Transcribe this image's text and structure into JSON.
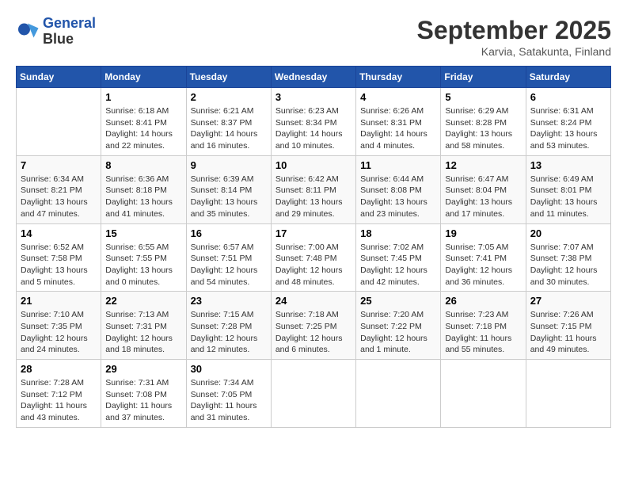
{
  "header": {
    "logo_line1": "General",
    "logo_line2": "Blue",
    "month": "September 2025",
    "location": "Karvia, Satakunta, Finland"
  },
  "days_of_week": [
    "Sunday",
    "Monday",
    "Tuesday",
    "Wednesday",
    "Thursday",
    "Friday",
    "Saturday"
  ],
  "weeks": [
    [
      {
        "num": "",
        "info": ""
      },
      {
        "num": "1",
        "info": "Sunrise: 6:18 AM\nSunset: 8:41 PM\nDaylight: 14 hours\nand 22 minutes."
      },
      {
        "num": "2",
        "info": "Sunrise: 6:21 AM\nSunset: 8:37 PM\nDaylight: 14 hours\nand 16 minutes."
      },
      {
        "num": "3",
        "info": "Sunrise: 6:23 AM\nSunset: 8:34 PM\nDaylight: 14 hours\nand 10 minutes."
      },
      {
        "num": "4",
        "info": "Sunrise: 6:26 AM\nSunset: 8:31 PM\nDaylight: 14 hours\nand 4 minutes."
      },
      {
        "num": "5",
        "info": "Sunrise: 6:29 AM\nSunset: 8:28 PM\nDaylight: 13 hours\nand 58 minutes."
      },
      {
        "num": "6",
        "info": "Sunrise: 6:31 AM\nSunset: 8:24 PM\nDaylight: 13 hours\nand 53 minutes."
      }
    ],
    [
      {
        "num": "7",
        "info": "Sunrise: 6:34 AM\nSunset: 8:21 PM\nDaylight: 13 hours\nand 47 minutes."
      },
      {
        "num": "8",
        "info": "Sunrise: 6:36 AM\nSunset: 8:18 PM\nDaylight: 13 hours\nand 41 minutes."
      },
      {
        "num": "9",
        "info": "Sunrise: 6:39 AM\nSunset: 8:14 PM\nDaylight: 13 hours\nand 35 minutes."
      },
      {
        "num": "10",
        "info": "Sunrise: 6:42 AM\nSunset: 8:11 PM\nDaylight: 13 hours\nand 29 minutes."
      },
      {
        "num": "11",
        "info": "Sunrise: 6:44 AM\nSunset: 8:08 PM\nDaylight: 13 hours\nand 23 minutes."
      },
      {
        "num": "12",
        "info": "Sunrise: 6:47 AM\nSunset: 8:04 PM\nDaylight: 13 hours\nand 17 minutes."
      },
      {
        "num": "13",
        "info": "Sunrise: 6:49 AM\nSunset: 8:01 PM\nDaylight: 13 hours\nand 11 minutes."
      }
    ],
    [
      {
        "num": "14",
        "info": "Sunrise: 6:52 AM\nSunset: 7:58 PM\nDaylight: 13 hours\nand 5 minutes."
      },
      {
        "num": "15",
        "info": "Sunrise: 6:55 AM\nSunset: 7:55 PM\nDaylight: 13 hours\nand 0 minutes."
      },
      {
        "num": "16",
        "info": "Sunrise: 6:57 AM\nSunset: 7:51 PM\nDaylight: 12 hours\nand 54 minutes."
      },
      {
        "num": "17",
        "info": "Sunrise: 7:00 AM\nSunset: 7:48 PM\nDaylight: 12 hours\nand 48 minutes."
      },
      {
        "num": "18",
        "info": "Sunrise: 7:02 AM\nSunset: 7:45 PM\nDaylight: 12 hours\nand 42 minutes."
      },
      {
        "num": "19",
        "info": "Sunrise: 7:05 AM\nSunset: 7:41 PM\nDaylight: 12 hours\nand 36 minutes."
      },
      {
        "num": "20",
        "info": "Sunrise: 7:07 AM\nSunset: 7:38 PM\nDaylight: 12 hours\nand 30 minutes."
      }
    ],
    [
      {
        "num": "21",
        "info": "Sunrise: 7:10 AM\nSunset: 7:35 PM\nDaylight: 12 hours\nand 24 minutes."
      },
      {
        "num": "22",
        "info": "Sunrise: 7:13 AM\nSunset: 7:31 PM\nDaylight: 12 hours\nand 18 minutes."
      },
      {
        "num": "23",
        "info": "Sunrise: 7:15 AM\nSunset: 7:28 PM\nDaylight: 12 hours\nand 12 minutes."
      },
      {
        "num": "24",
        "info": "Sunrise: 7:18 AM\nSunset: 7:25 PM\nDaylight: 12 hours\nand 6 minutes."
      },
      {
        "num": "25",
        "info": "Sunrise: 7:20 AM\nSunset: 7:22 PM\nDaylight: 12 hours\nand 1 minute."
      },
      {
        "num": "26",
        "info": "Sunrise: 7:23 AM\nSunset: 7:18 PM\nDaylight: 11 hours\nand 55 minutes."
      },
      {
        "num": "27",
        "info": "Sunrise: 7:26 AM\nSunset: 7:15 PM\nDaylight: 11 hours\nand 49 minutes."
      }
    ],
    [
      {
        "num": "28",
        "info": "Sunrise: 7:28 AM\nSunset: 7:12 PM\nDaylight: 11 hours\nand 43 minutes."
      },
      {
        "num": "29",
        "info": "Sunrise: 7:31 AM\nSunset: 7:08 PM\nDaylight: 11 hours\nand 37 minutes."
      },
      {
        "num": "30",
        "info": "Sunrise: 7:34 AM\nSunset: 7:05 PM\nDaylight: 11 hours\nand 31 minutes."
      },
      {
        "num": "",
        "info": ""
      },
      {
        "num": "",
        "info": ""
      },
      {
        "num": "",
        "info": ""
      },
      {
        "num": "",
        "info": ""
      }
    ]
  ]
}
